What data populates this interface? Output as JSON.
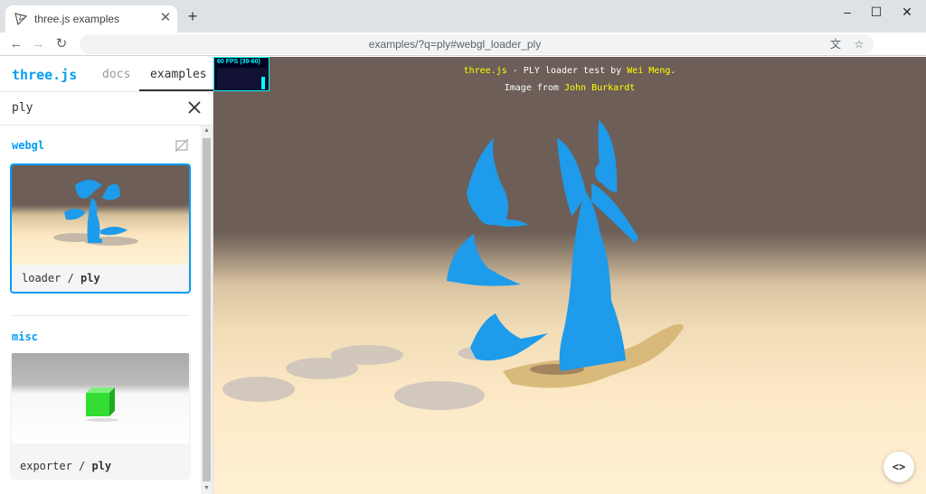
{
  "browser": {
    "tab_title": "three.js examples",
    "tab_close_icon": "close-icon",
    "new_tab_label": "+",
    "url": "examples/?q=ply#webgl_loader_ply",
    "window_controls": [
      "minimize",
      "maximize",
      "close"
    ]
  },
  "sidebar": {
    "brand": "three.js",
    "nav": {
      "docs": "docs",
      "examples": "examples"
    },
    "search": {
      "value": "ply"
    },
    "categories": [
      {
        "name": "webgl",
        "items": [
          {
            "prefix": "loader / ",
            "name": "ply",
            "selected": true
          }
        ]
      },
      {
        "name": "misc",
        "items": [
          {
            "prefix": "exporter / ",
            "name": "ply",
            "selected": false
          }
        ]
      }
    ]
  },
  "viewport": {
    "stats": "60 FPS (39-60)",
    "info_line1": {
      "link1": "three.js",
      "text1": " - PLY loader test by ",
      "link2": "Wei Meng",
      "text2": "."
    },
    "info_line2": {
      "text": "Image from ",
      "link": "John Burkardt"
    },
    "code_button": "<>"
  },
  "colors": {
    "accent": "#049ef4",
    "model": "#1e9bea",
    "link_yellow": "#ffff00"
  }
}
